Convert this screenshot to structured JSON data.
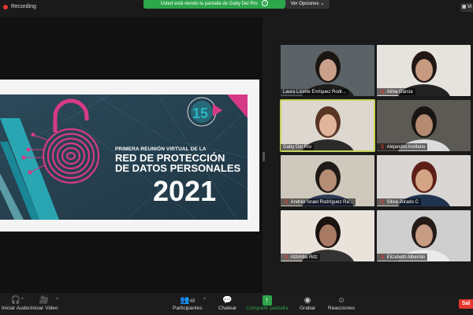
{
  "topbar": {
    "recording_label": "Recording",
    "share_notice": "Usted está viendo la pantalla de Gaby Del Río",
    "view_options_label": "Ver Opciones",
    "view_button_label": "Vi"
  },
  "slide": {
    "title_line1": "PRIMERA REUNIÓN VIRTUAL DE LA",
    "title_line2": "RED DE PROTECCIÓN",
    "title_line3": "DE DATOS PERSONALES",
    "year": "2021",
    "logo_number": "15"
  },
  "participants": [
    {
      "name": "Laura Lizette Enríquez Rodr...",
      "muted": false,
      "bg": "#5b6366",
      "skin": "#caa08a",
      "hair": "#1b1512",
      "shirt": "#1d1d1d"
    },
    {
      "name": "Alma Garcia",
      "muted": true,
      "bg": "#e6e3df",
      "skin": "#c79a80",
      "hair": "#201714",
      "shirt": "#222"
    },
    {
      "name": "Gaby Del Río",
      "muted": false,
      "bg": "#dcd7cf",
      "skin": "#e1b59c",
      "hair": "#5a3424",
      "shirt": "#2b2b2b"
    },
    {
      "name": "Alejandro Arellano",
      "muted": true,
      "bg": "#5c5a55",
      "skin": "#b48a70",
      "hair": "#191512",
      "shirt": "#dcdcdc"
    },
    {
      "name": "Andrés Israel Rodríguez Ra...",
      "muted": true,
      "bg": "#cfc9bd",
      "skin": "#b58c74",
      "hair": "#1e1a16",
      "shirt": "#2f3b55"
    },
    {
      "name": "Silvia Jurado C",
      "muted": true,
      "bg": "#d9d6d3",
      "skin": "#d4a487",
      "hair": "#5c1f17",
      "shirt": "#20344f"
    },
    {
      "name": "Atzimba Rdz",
      "muted": true,
      "bg": "#e9e3dc",
      "skin": "#a97a63",
      "hair": "#1a1310",
      "shirt": "#333"
    },
    {
      "name": "Elizabeth Alberrán",
      "muted": true,
      "bg": "#cfcfcf",
      "skin": "#c89b85",
      "hair": "#241a16",
      "shirt": "#eaeaea"
    }
  ],
  "toolbar": {
    "audio_label": "Iniciar Audio",
    "video_label": "Iniciar Video",
    "participants_label": "Participantes",
    "participants_count": "49",
    "chat_label": "Chatear",
    "share_label": "Compartir pantalla",
    "record_label": "Grabar",
    "reactions_label": "Reacciones",
    "end_label": "Sal"
  },
  "colors": {
    "accent_green": "#2da54b",
    "active_speaker": "#c7d35a",
    "end_red": "#e5372f",
    "slide_magenta": "#d63a86",
    "slide_teal": "#2ab7c3"
  }
}
